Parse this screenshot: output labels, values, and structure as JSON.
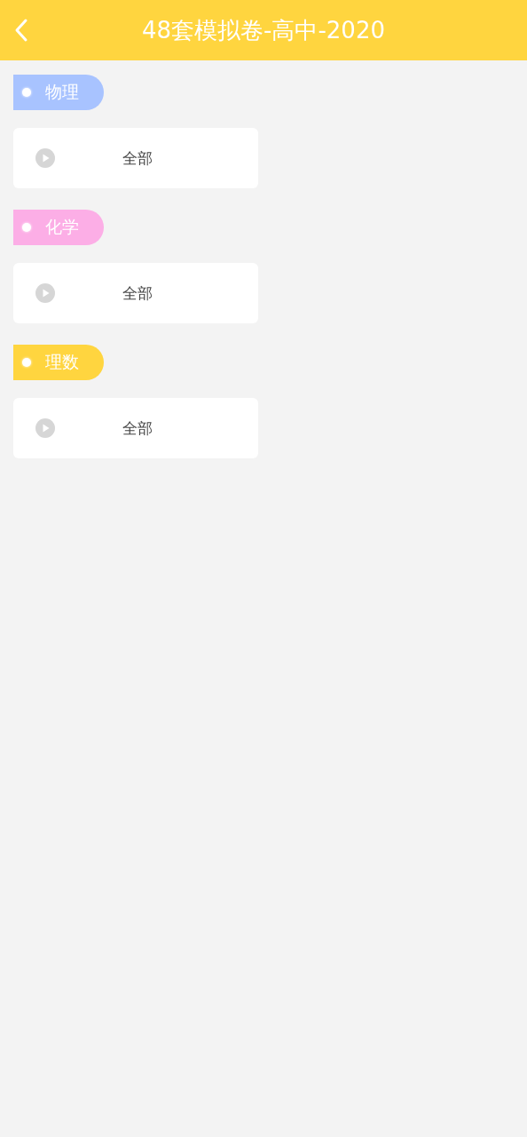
{
  "header": {
    "title": "48套模拟卷-高中-2020"
  },
  "sections": [
    {
      "subject": "物理",
      "color": "#a8c3ff",
      "items": [
        {
          "label": "全部"
        }
      ]
    },
    {
      "subject": "化学",
      "color": "#fcaee6",
      "items": [
        {
          "label": "全部"
        }
      ]
    },
    {
      "subject": "理数",
      "color": "#ffd53f",
      "items": [
        {
          "label": "全部"
        }
      ]
    }
  ]
}
